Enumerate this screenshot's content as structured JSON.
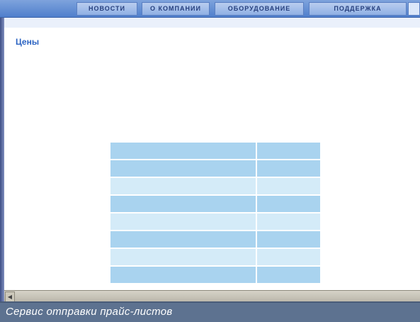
{
  "nav": {
    "items": [
      {
        "label": "НОВОСТИ"
      },
      {
        "label": "О КОМПАНИИ"
      },
      {
        "label": "ОБОРУДОВАНИЕ"
      },
      {
        "label": "ПОДДЕРЖКА"
      }
    ]
  },
  "breadcrumb": "",
  "page": {
    "title": "Цены",
    "intro": "",
    "paragraph1": "",
    "paragraph2_prefix": "",
    "paragraph2_link": "",
    "bold_line": "",
    "signature": [
      "",
      "",
      ""
    ]
  },
  "price_table": {
    "rows": [
      {
        "name": "",
        "link": ""
      },
      {
        "name": "",
        "link": ""
      },
      {
        "name": "",
        "link": ""
      },
      {
        "name": "",
        "link": ""
      },
      {
        "name": "",
        "link": ""
      },
      {
        "name": "",
        "link": ""
      },
      {
        "name": "",
        "link": ""
      },
      {
        "name": "",
        "link": ""
      }
    ]
  },
  "caption": "Сервис отправки прайс-листов",
  "colors": {
    "nav_bar": "#4f7fcc",
    "title": "#2b63c2",
    "body_text": "#c2392f",
    "table_row_dark": "#a9d3ef",
    "table_row_light": "#d4ebf8",
    "caption_bar": "#5d7290"
  }
}
